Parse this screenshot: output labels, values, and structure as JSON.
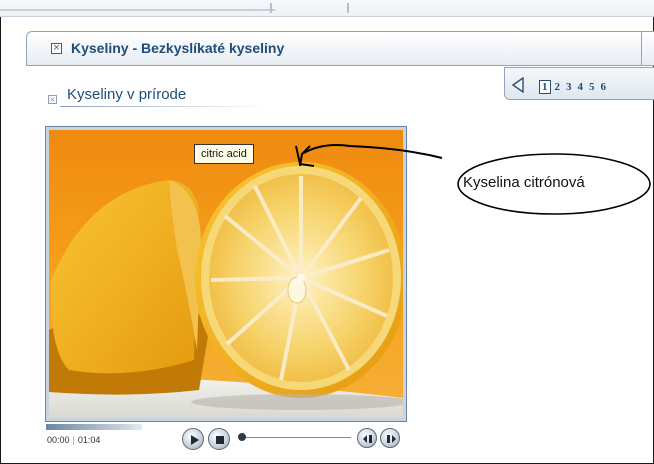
{
  "header": {
    "title": "Kyseliny - Bezkyslíkaté kyseliny",
    "collapse_icon": "close-box-icon"
  },
  "pager": {
    "prev_icon": "triangle-left-icon",
    "pages": [
      "1",
      "2",
      "3",
      "4",
      "5",
      "6"
    ],
    "active_page": "1"
  },
  "section": {
    "title": "Kyseliny v prírode",
    "icon": "close-box-icon"
  },
  "media": {
    "image_subject": "halved lemon on orange background",
    "tooltip": "citric acid",
    "time_current": "00:00",
    "time_total": "01:04",
    "progress": 0.0,
    "controls": [
      "play-icon",
      "stop-icon",
      "seek-slider",
      "rewind-icon",
      "forward-icon"
    ]
  },
  "annotation": {
    "label": "Kyselina citrónová"
  }
}
